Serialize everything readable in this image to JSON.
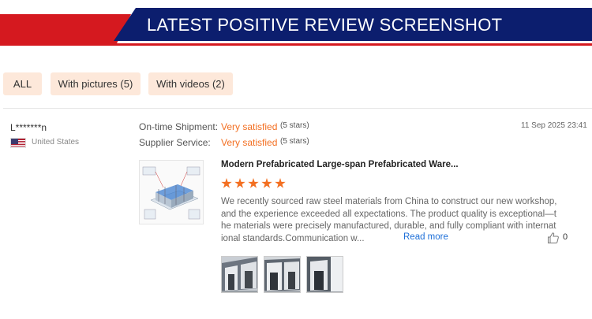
{
  "banner": {
    "title": "LATEST POSITIVE REVIEW SCREENSHOT"
  },
  "filters": [
    {
      "label": "ALL"
    },
    {
      "label": "With pictures (5)"
    },
    {
      "label": "With videos (2)"
    }
  ],
  "review": {
    "reviewer": {
      "name": "L*******n",
      "country": "United States",
      "flag_icon": "us-flag-icon"
    },
    "ratings": [
      {
        "label": "On-time Shipment:",
        "value": "Very satisfied",
        "stars": "(5 stars)"
      },
      {
        "label": "Supplier Service:",
        "value": "Very satisfied",
        "stars": "(5 stars)"
      }
    ],
    "date": "11 Sep 2025 23:41",
    "product": {
      "title": "Modern Prefabricated Large-span Prefabricated Ware...",
      "rating_stars": 5
    },
    "text_lines": [
      "We recently sourced raw steel materials from China to construct our new workshop,",
      "and the experience exceeded all expectations. The product quality is exceptional—t",
      "he materials were precisely manufactured, durable, and fully compliant with internat",
      "ional standards.Communication w..."
    ],
    "read_more": "Read more",
    "likes": "0",
    "photos": 3
  },
  "colors": {
    "banner_red": "#d5191f",
    "banner_navy": "#0c1e6e",
    "accent_orange": "#f36f21",
    "link_blue": "#1d6fd8",
    "filter_bg": "#fde8da"
  }
}
